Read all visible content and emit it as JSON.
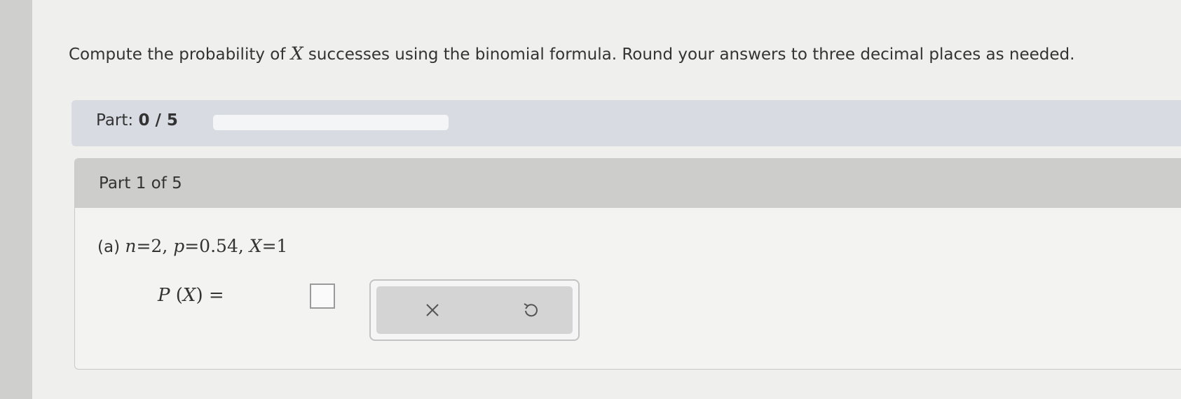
{
  "instructions": {
    "before": "Compute the probability of ",
    "variable": "X",
    "after": " successes using the binomial formula. Round your answers to three decimal places as needed."
  },
  "progress": {
    "label": "Part: ",
    "value": "0 / 5",
    "fraction": 0
  },
  "part": {
    "title": "Part 1 of 5"
  },
  "question": {
    "prefix": "(a) ",
    "n_var": "n",
    "n_val": "=2, ",
    "p_var": "p",
    "p_val": "=0.54, ",
    "x_var": "X",
    "x_val": "=1"
  },
  "answer": {
    "p": "P",
    "open": " (",
    "x": "X",
    "close_eq": ") = ",
    "value": ""
  },
  "tools": {
    "clear_icon": "close-icon",
    "undo_icon": "undo-icon"
  }
}
